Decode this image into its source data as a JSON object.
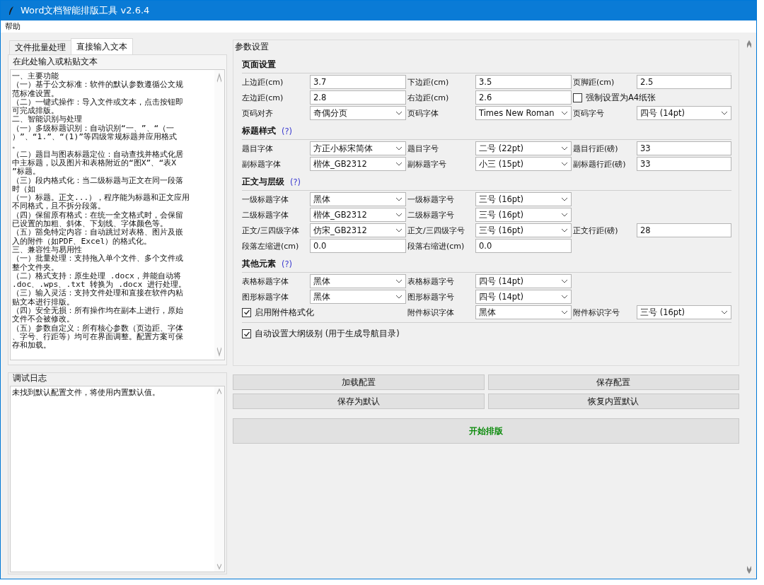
{
  "window": {
    "title": "Word文档智能排版工具 v2.6.4"
  },
  "menu": [
    {
      "label": "帮助"
    }
  ],
  "tabs": [
    {
      "label": "文件批量处理",
      "selected": false
    },
    {
      "label": "直接输入文本",
      "selected": true
    }
  ],
  "input_group": {
    "title": "在此处输入或粘贴文本",
    "lines": [
      "一、主要功能",
      "（一）基于公文标准：软件的默认参数遵循公文规",
      "范标准设置。",
      "（二）一键式操作：导入文件或文本，点击按钮即",
      "可完成排版。",
      "二、智能识别与处理",
      "（一）多级标题识别：自动识别“一、”、“（一",
      "）”、“1.”、“(1)”等四级常规标题并应用格式",
      "。",
      "（二）题目与图表标题定位：自动查找并格式化居",
      "中主标题，以及图片和表格附近的“图X”、“表X",
      "”标题。",
      "（三）段内格式化：当二级标题与正文在同一段落",
      "时（如",
      "（一）标题。正文...），程序能为标题和正文应用",
      "不同格式，且不拆分段落。",
      "（四）保留原有格式：在统一全文格式时，会保留",
      "已设置的加粗、斜体、下划线、字体颜色等。",
      "（五）豁免特定内容：自动跳过对表格、图片及嵌",
      "入的附件（如PDF、Excel）的格式化。",
      "三、兼容性与易用性",
      "（一）批量处理：支持拖入单个文件、多个文件或",
      "整个文件夹。",
      "（二）格式支持：原生处理 .docx，并能自动将",
      ".doc、.wps、.txt 转换为 .docx 进行处理。",
      "（三）输入灵活：支持文件处理和直接在软件内粘",
      "贴文本进行排版。",
      "（四）安全无损：所有操作均在副本上进行，原始",
      "文件不会被修改。",
      "（五）参数自定义：所有核心参数（页边距、字体",
      "、字号、行距等）均可在界面调整。配置方案可保",
      "存和加载。"
    ]
  },
  "log_group": {
    "title": "调试日志",
    "lines": [
      "未找到默认配置文件，将使用内置默认值。"
    ]
  },
  "settings": {
    "title": "参数设置",
    "sections": [
      {
        "title": "页面设置",
        "rows": [
          [
            {
              "kind": "label",
              "text": "上边距(cm)"
            },
            {
              "kind": "input",
              "value": "3.7"
            },
            {
              "kind": "label",
              "text": "下边距(cm)"
            },
            {
              "kind": "input",
              "value": "3.5"
            },
            {
              "kind": "label",
              "text": "页脚距(cm)"
            },
            {
              "kind": "input",
              "value": "2.5"
            }
          ],
          [
            {
              "kind": "label",
              "text": "左边距(cm)"
            },
            {
              "kind": "input",
              "value": "2.8"
            },
            {
              "kind": "label",
              "text": "右边距(cm)"
            },
            {
              "kind": "input",
              "value": "2.6"
            },
            {
              "kind": "checkbox",
              "text": "强制设置为A4纸张",
              "checked": false
            },
            {
              "kind": "empty"
            }
          ],
          [
            {
              "kind": "label",
              "text": "页码对齐"
            },
            {
              "kind": "select",
              "value": "奇偶分页"
            },
            {
              "kind": "label",
              "text": "页码字体"
            },
            {
              "kind": "select",
              "value": "Times New Roman"
            },
            {
              "kind": "label",
              "text": "页码字号"
            },
            {
              "kind": "select",
              "value": "四号 (14pt)"
            }
          ]
        ]
      },
      {
        "title": "标题样式",
        "help": "(?)",
        "rows": [
          [
            {
              "kind": "label",
              "text": "题目字体"
            },
            {
              "kind": "select",
              "value": "方正小标宋简体"
            },
            {
              "kind": "label",
              "text": "题目字号"
            },
            {
              "kind": "select",
              "value": "二号 (22pt)"
            },
            {
              "kind": "label",
              "text": "题目行距(磅)"
            },
            {
              "kind": "input",
              "value": "33"
            }
          ],
          [
            {
              "kind": "label",
              "text": "副标题字体"
            },
            {
              "kind": "select",
              "value": "楷体_GB2312"
            },
            {
              "kind": "label",
              "text": "副标题字号"
            },
            {
              "kind": "select",
              "value": "小三 (15pt)"
            },
            {
              "kind": "label",
              "text": "副标题行距(磅)"
            },
            {
              "kind": "input",
              "value": "33"
            }
          ]
        ]
      },
      {
        "title": "正文与层级",
        "help": "(?)",
        "rows": [
          [
            {
              "kind": "label",
              "text": "一级标题字体"
            },
            {
              "kind": "select",
              "value": "黑体"
            },
            {
              "kind": "label",
              "text": "一级标题字号"
            },
            {
              "kind": "select",
              "value": "三号 (16pt)"
            }
          ],
          [
            {
              "kind": "label",
              "text": "二级标题字体"
            },
            {
              "kind": "select",
              "value": "楷体_GB2312"
            },
            {
              "kind": "label",
              "text": "二级标题字号"
            },
            {
              "kind": "select",
              "value": "三号 (16pt)"
            }
          ],
          [
            {
              "kind": "label",
              "text": "正文/三四级字体"
            },
            {
              "kind": "select",
              "value": "仿宋_GB2312"
            },
            {
              "kind": "label",
              "text": "正文/三四级字号"
            },
            {
              "kind": "select",
              "value": "三号 (16pt)"
            },
            {
              "kind": "label",
              "text": "正文行距(磅)"
            },
            {
              "kind": "input",
              "value": "28"
            }
          ],
          [
            {
              "kind": "label",
              "text": "段落左缩进(cm)"
            },
            {
              "kind": "input",
              "value": "0.0"
            },
            {
              "kind": "label",
              "text": "段落右缩进(cm)"
            },
            {
              "kind": "input",
              "value": "0.0"
            }
          ]
        ]
      },
      {
        "title": "其他元素",
        "help": "(?)",
        "rows": [
          [
            {
              "kind": "label",
              "text": "表格标题字体"
            },
            {
              "kind": "select",
              "value": "黑体"
            },
            {
              "kind": "label",
              "text": "表格标题字号"
            },
            {
              "kind": "select",
              "value": "四号 (14pt)"
            }
          ],
          [
            {
              "kind": "label",
              "text": "图形标题字体"
            },
            {
              "kind": "select",
              "value": "黑体"
            },
            {
              "kind": "label",
              "text": "图形标题字号"
            },
            {
              "kind": "select",
              "value": "四号 (14pt)"
            }
          ],
          [
            {
              "kind": "checkbox",
              "text": "启用附件格式化",
              "checked": true
            },
            {
              "kind": "empty"
            },
            {
              "kind": "label",
              "text": "附件标识字体"
            },
            {
              "kind": "select",
              "value": "黑体"
            },
            {
              "kind": "label",
              "text": "附件标识字号"
            },
            {
              "kind": "select",
              "value": "三号 (16pt)"
            }
          ]
        ]
      }
    ],
    "footer_checkbox": {
      "text": "自动设置大纲级别 (用于生成导航目录)",
      "checked": true
    }
  },
  "buttons": [
    {
      "label": "加载配置",
      "kind": "secondary"
    },
    {
      "label": "保存配置",
      "kind": "secondary"
    },
    {
      "label": "保存为默认",
      "kind": "secondary"
    },
    {
      "label": "恢复内置默认",
      "kind": "secondary"
    },
    {
      "label": "开始排版",
      "kind": "primary"
    }
  ]
}
